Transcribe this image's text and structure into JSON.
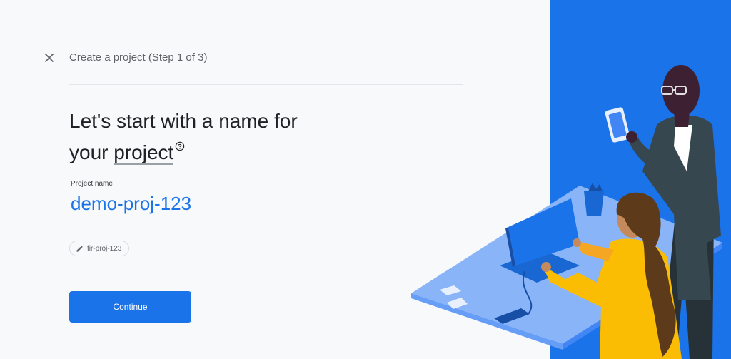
{
  "header": {
    "step_title": "Create a project (Step 1 of 3)"
  },
  "main": {
    "heading_line1": "Let's start with a name for",
    "heading_line2_prefix": "your ",
    "heading_line2_underlined": "project",
    "project_name_label": "Project name",
    "project_name_value": "demo-proj-123",
    "project_id_chip": "fir-proj-123",
    "continue_label": "Continue"
  },
  "icons": {
    "close": "close-icon",
    "help": "help-circle-icon",
    "edit": "pencil-icon"
  },
  "colors": {
    "accent": "#1a73e8",
    "background": "#f8f9fa",
    "text": "#202124",
    "muted": "#5f6368"
  }
}
